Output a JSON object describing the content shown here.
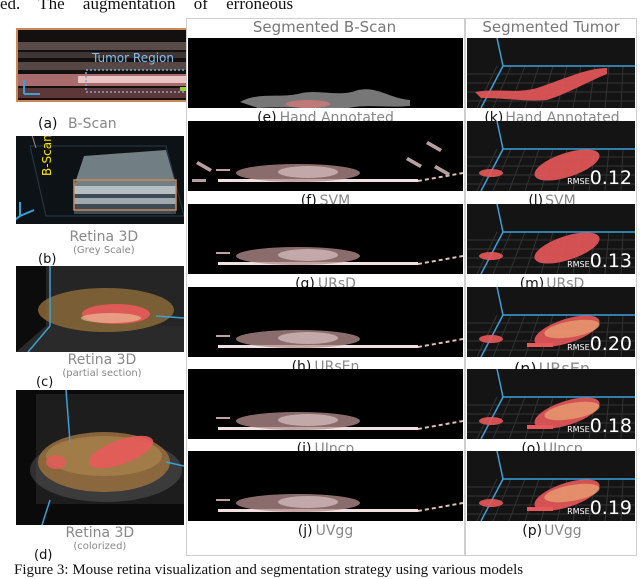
{
  "top_text": "ed.   The   augmentation   of   erroneous",
  "caption": "Figure 3: Mouse retina visualization and segmentation strategy using various models",
  "left_panel": {
    "a": {
      "tag": "(a)",
      "name": "B-Scan",
      "overlay_label": "Tumor Region"
    },
    "b": {
      "tag": "(b)",
      "name": "Retina 3D",
      "sub": "(Grey Scale)",
      "overlay_label": "B-Scan"
    },
    "c": {
      "tag": "(c)",
      "name": "Retina 3D",
      "sub": "(partial section)"
    },
    "d": {
      "tag": "(d)",
      "name": "Retina 3D",
      "sub": "(colorized)"
    }
  },
  "middle_column": {
    "header": "Segmented B-Scan",
    "panels": [
      {
        "tag": "(e)",
        "name": "Hand Annotated"
      },
      {
        "tag": "(f)",
        "name": "SVM"
      },
      {
        "tag": "(g)",
        "name": "URsD"
      },
      {
        "tag": "(h)",
        "name": "URsEn"
      },
      {
        "tag": "(i)",
        "name": "UIncp"
      },
      {
        "tag": "(j)",
        "name": "UVgg"
      }
    ]
  },
  "right_column": {
    "header": "Segmented Tumor",
    "rmse_label": "RMSE",
    "panels": [
      {
        "tag": "(k)",
        "name": "Hand Annotated",
        "rmse": null
      },
      {
        "tag": "(l)",
        "name": "SVM",
        "rmse": "0.12"
      },
      {
        "tag": "(m)",
        "name": "URsD",
        "rmse": "0.13"
      },
      {
        "tag": "(n)",
        "name": "URsEn",
        "rmse": "0.20"
      },
      {
        "tag": "(o)",
        "name": "UIncp",
        "rmse": "0.18"
      },
      {
        "tag": "(p)",
        "name": "UVgg",
        "rmse": "0.19"
      }
    ]
  },
  "colors": {
    "tumor": "#e8585a",
    "axis_blue": "#3aa0d8",
    "frame_orange": "#c98a5a",
    "arrow_green": "#9acd32",
    "label_yellow": "#ffe000"
  }
}
